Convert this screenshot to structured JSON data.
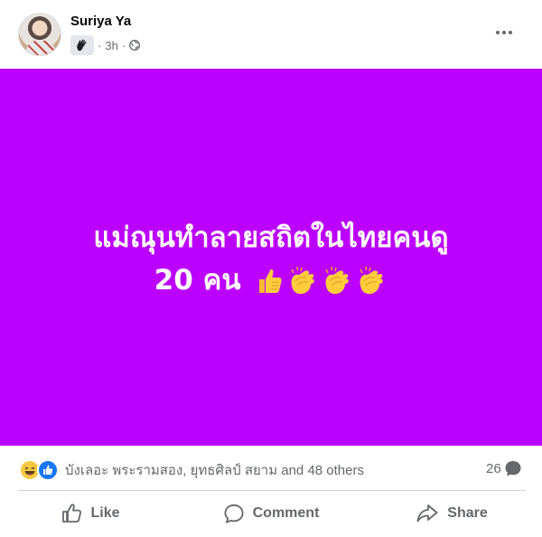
{
  "post": {
    "author": "Suriya Ya",
    "time": "3h",
    "separator": "·",
    "text_line1": "แม่ณุนทำลายสถิตในไทยคนดู",
    "text_line2": "20 คน",
    "emoji": [
      "thumbs-up",
      "clapping-hands",
      "clapping-hands",
      "clapping-hands"
    ],
    "background_color": "#bb00ff"
  },
  "reactions": {
    "names": "บังเลอะ พระรามสอง, ยุทธศิลป์ สยาม and 48 others",
    "types": [
      "haha",
      "like"
    ],
    "comment_count": "26"
  },
  "actions": {
    "like_label": "Like",
    "comment_label": "Comment",
    "share_label": "Share"
  }
}
